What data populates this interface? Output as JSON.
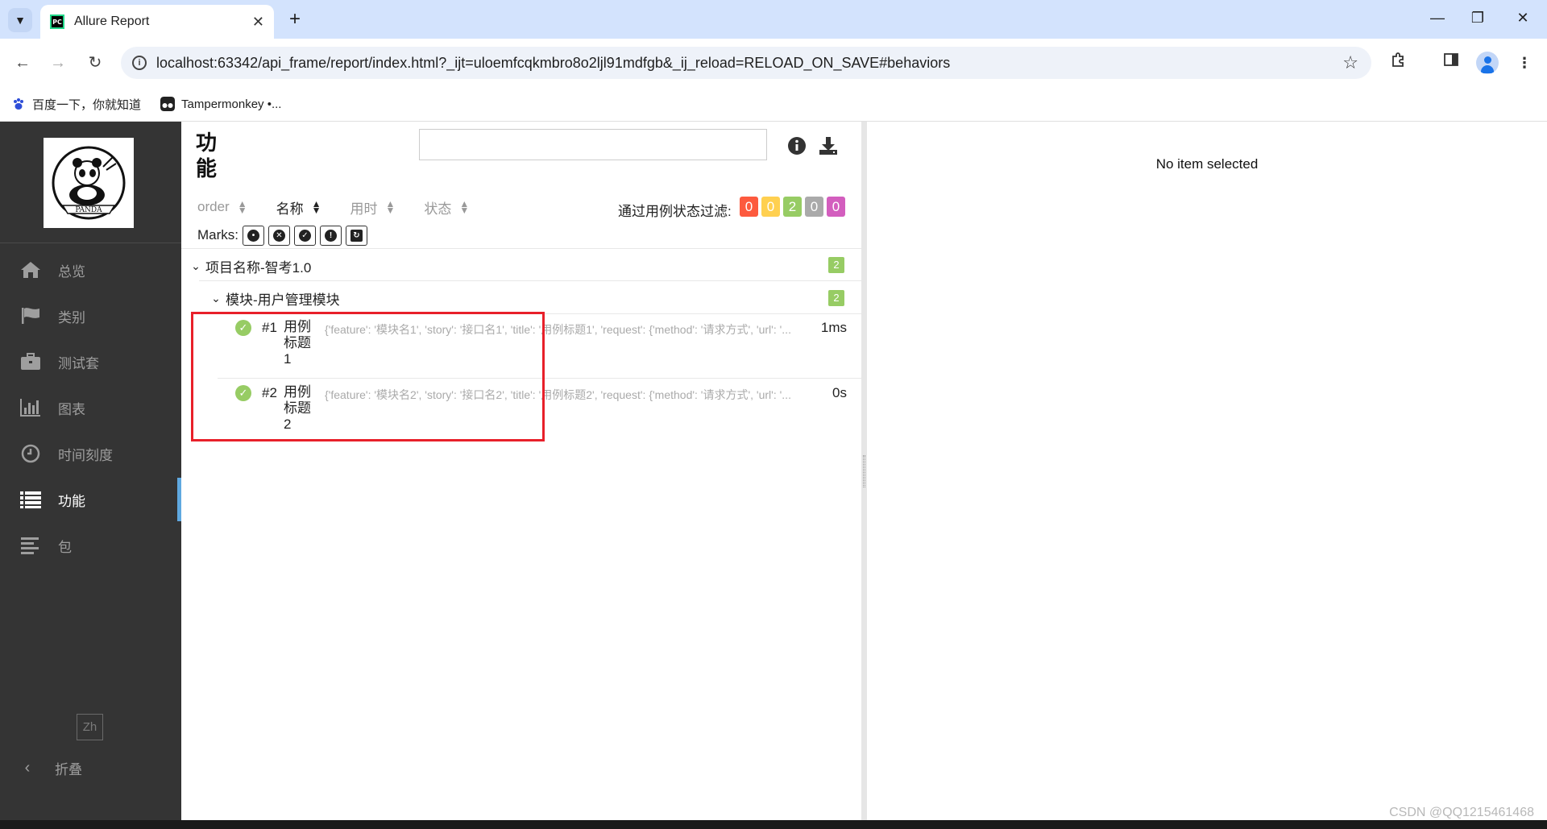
{
  "browser": {
    "tab_title": "Allure Report",
    "tab_favicon_text": "PC",
    "url": "localhost:63342/api_frame/report/index.html?_ijt=uloemfcqkmbro8o2ljl91mdfgb&_ij_reload=RELOAD_ON_SAVE#behaviors",
    "bookmarks": [
      {
        "label": "百度一下，你就知道",
        "icon": "baidu-paw-icon"
      },
      {
        "label": "Tampermonkey •...",
        "icon": "tampermonkey-icon"
      }
    ],
    "colors": {
      "tabbar": "#d3e3fd",
      "omnibox": "#eef2f9"
    }
  },
  "sidebar": {
    "logo_text": "PANDA",
    "items": [
      {
        "label": "总览",
        "icon": "home-icon"
      },
      {
        "label": "类别",
        "icon": "flag-icon"
      },
      {
        "label": "测试套",
        "icon": "briefcase-icon"
      },
      {
        "label": "图表",
        "icon": "bar-chart-icon"
      },
      {
        "label": "时间刻度",
        "icon": "clock-icon"
      },
      {
        "label": "功能",
        "icon": "list-icon",
        "active": true
      },
      {
        "label": "包",
        "icon": "align-left-icon"
      }
    ],
    "lang": "Zh",
    "collapse_label": "折叠",
    "colors": {
      "background": "#343434",
      "active_marker": "#5fa8e0"
    }
  },
  "pane": {
    "title": "功能",
    "search_value": "",
    "sort": [
      {
        "label": "order",
        "active": false
      },
      {
        "label": "名称",
        "active": true
      },
      {
        "label": "用时",
        "active": false
      },
      {
        "label": "状态",
        "active": false
      }
    ],
    "filter_label": "通过用例状态过滤:",
    "status_counts": [
      {
        "status": "failed",
        "count": "0",
        "color": "#fd5a3e"
      },
      {
        "status": "broken",
        "count": "0",
        "color": "#ffd050"
      },
      {
        "status": "passed",
        "count": "2",
        "color": "#97cc64"
      },
      {
        "status": "skipped",
        "count": "0",
        "color": "#aaaaaa"
      },
      {
        "status": "unknown",
        "count": "0",
        "color": "#d35ebe"
      }
    ],
    "marks_label": "Marks:",
    "marks": [
      "flaky-bomb-icon",
      "new-failed-icon",
      "new-passed-icon",
      "new-broken-icon",
      "retries-icon"
    ],
    "tree": {
      "epic": {
        "label": "项目名称-智考1.0",
        "count": "2"
      },
      "feature": {
        "label": "模块-用户管理模块",
        "count": "2"
      },
      "cases": [
        {
          "num": "#1",
          "title": "用例标题1",
          "params": "{'feature': '模块名1', 'story': '接口名1', 'title': '用例标题1', 'request': {'method': '请求方式', 'url': '...",
          "duration": "1ms",
          "status": "passed"
        },
        {
          "num": "#2",
          "title": "用例标题2",
          "params": "{'feature': '模块名2', 'story': '接口名2', 'title': '用例标题2', 'request': {'method': '请求方式', 'url': '...",
          "duration": "0s",
          "status": "passed"
        }
      ]
    }
  },
  "detail": {
    "empty_text": "No item selected"
  },
  "watermark": "CSDN @QQ1215461468"
}
